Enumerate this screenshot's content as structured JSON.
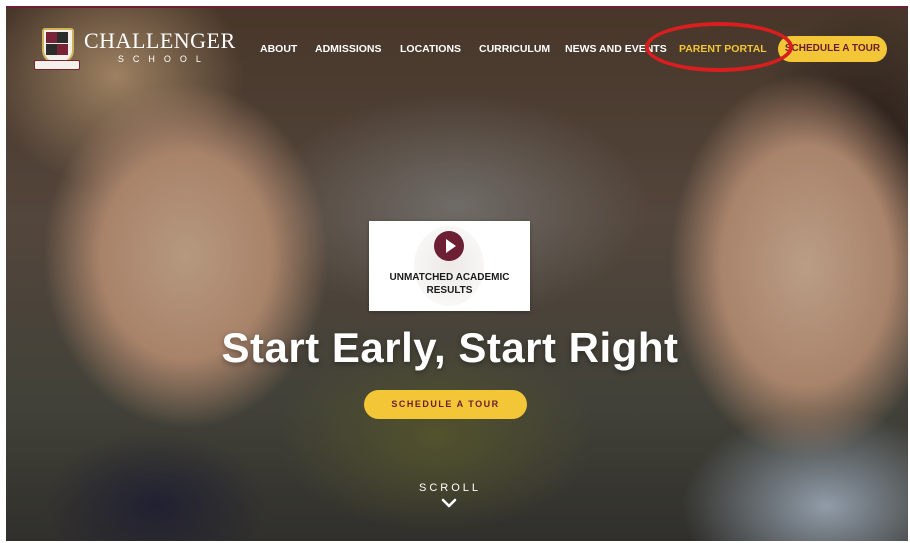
{
  "brand": {
    "name": "CHALLENGER",
    "sub": "SCHOOL"
  },
  "nav": {
    "items": [
      {
        "label": "ABOUT"
      },
      {
        "label": "ADMISSIONS"
      },
      {
        "label": "LOCATIONS"
      },
      {
        "label": "CURRICULUM"
      },
      {
        "label": "NEWS AND EVENTS"
      }
    ],
    "parent_portal": "PARENT PORTAL",
    "schedule_tour": "SCHEDULE A TOUR"
  },
  "hero": {
    "video_title": "UNMATCHED ACADEMIC RESULTS",
    "headline": "Start Early, Start Right",
    "cta": "SCHEDULE A TOUR",
    "scroll": "SCROLL"
  },
  "icons": {
    "crest": "school-crest-icon",
    "play": "play-icon",
    "scroll": "chevron-down-icon"
  },
  "colors": {
    "accent_yellow": "#f2c637",
    "brand_maroon": "#6d1f34",
    "annotation_red": "#d81e1e"
  }
}
